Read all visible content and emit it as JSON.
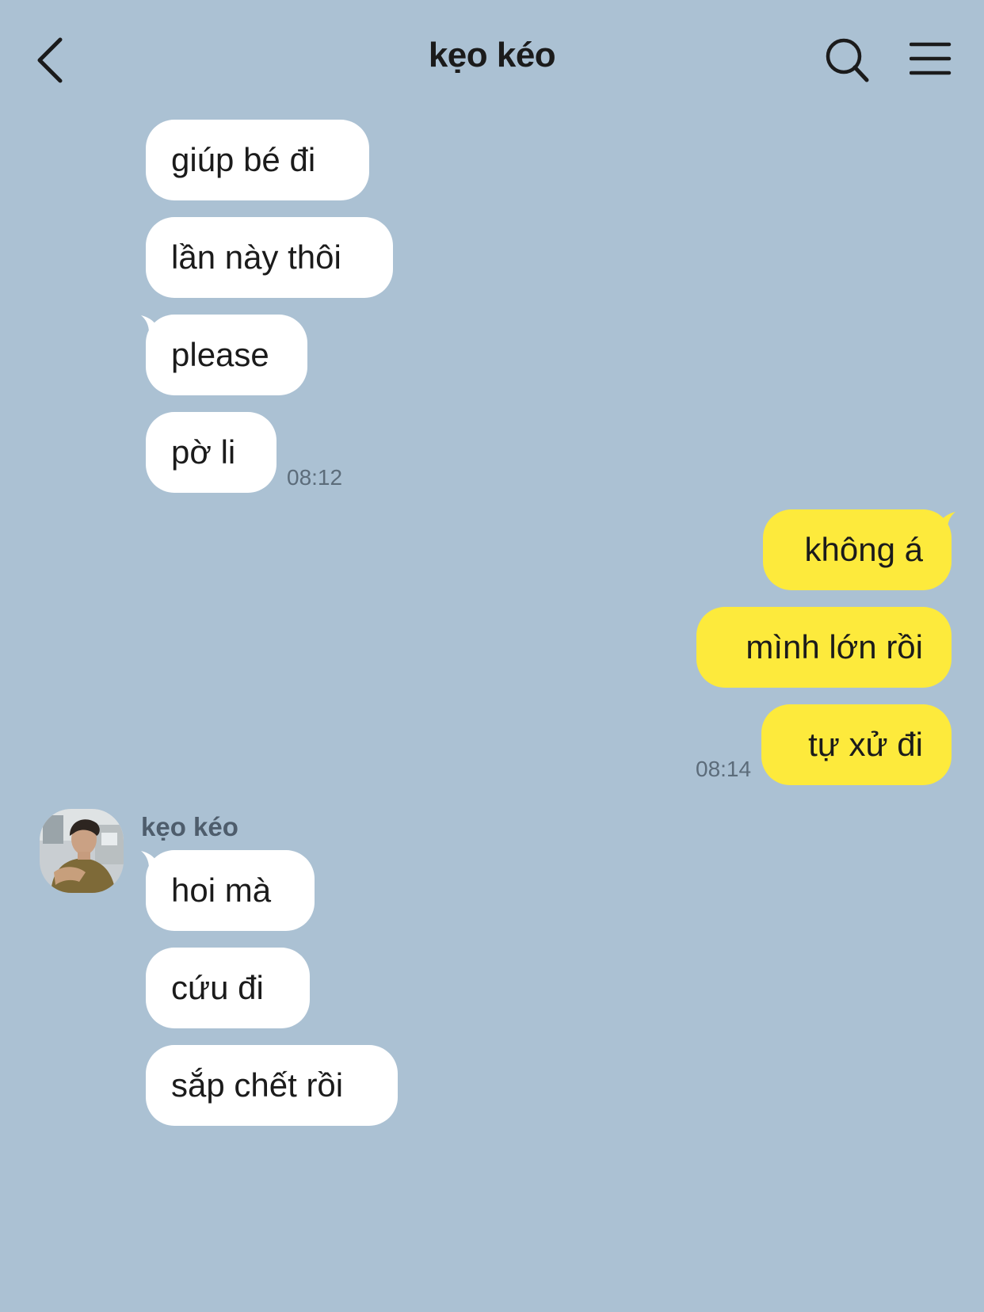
{
  "header": {
    "title": "kẹo kéo",
    "back_icon": "chevron-left-icon",
    "search_icon": "search-icon",
    "menu_icon": "hamburger-menu-icon"
  },
  "colors": {
    "background": "#abc1d3",
    "incoming_bubble": "#ffffff",
    "outgoing_bubble": "#fdea3c",
    "timestamp": "#5c6c7a"
  },
  "chat": {
    "group1": {
      "messages": [
        "giúp bé đi",
        "lần này thôi",
        "please",
        "pờ li"
      ],
      "time": "08:12"
    },
    "group2": {
      "messages": [
        "không á",
        "mình lớn rồi",
        "tự xử đi"
      ],
      "time": "08:14"
    },
    "group3": {
      "sender": "kẹo kéo",
      "messages": [
        "hoi mà",
        "cứu đi",
        "sắp chết rồi"
      ]
    }
  }
}
